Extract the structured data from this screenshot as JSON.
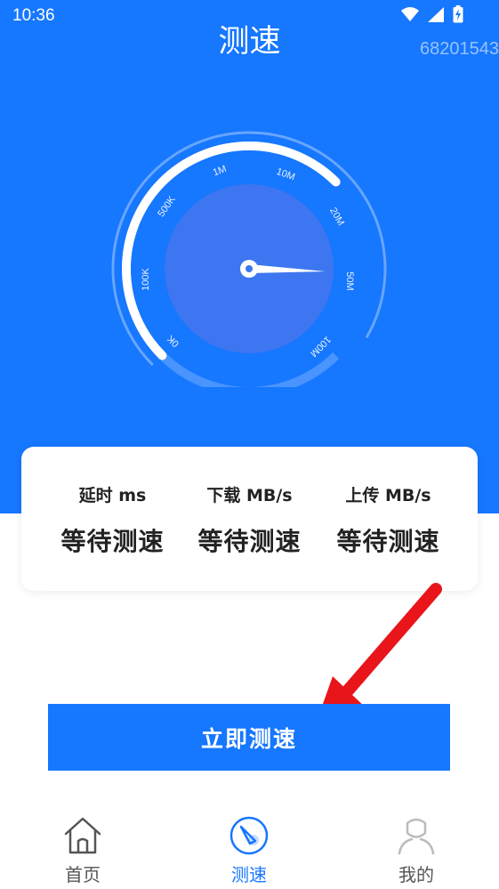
{
  "status_bar": {
    "time": "10:36",
    "icons": [
      "wifi-icon",
      "signal-icon",
      "battery-charging-icon"
    ]
  },
  "header": {
    "title": "测速",
    "watermark": "68201543"
  },
  "gauge": {
    "scale_labels": [
      "0K",
      "100K",
      "500K",
      "1M",
      "10M",
      "20M",
      "50M",
      "100M"
    ],
    "needle_value": "50M"
  },
  "results": {
    "items": [
      {
        "label": "延时 ms",
        "value": "等待测速"
      },
      {
        "label": "下载 MB/s",
        "value": "等待测速"
      },
      {
        "label": "上传 MB/s",
        "value": "等待测速"
      }
    ]
  },
  "start_button": {
    "label": "立即测速"
  },
  "bottom_nav": {
    "items": [
      {
        "label": "首页",
        "icon": "home-icon",
        "active": false
      },
      {
        "label": "测速",
        "icon": "speedometer-icon",
        "active": true
      },
      {
        "label": "我的",
        "icon": "user-icon",
        "active": false
      }
    ]
  },
  "colors": {
    "primary": "#1677ff",
    "gauge_inner": "#3d76f0",
    "nav_inactive": "#555555",
    "arrow": "#e8151b"
  }
}
